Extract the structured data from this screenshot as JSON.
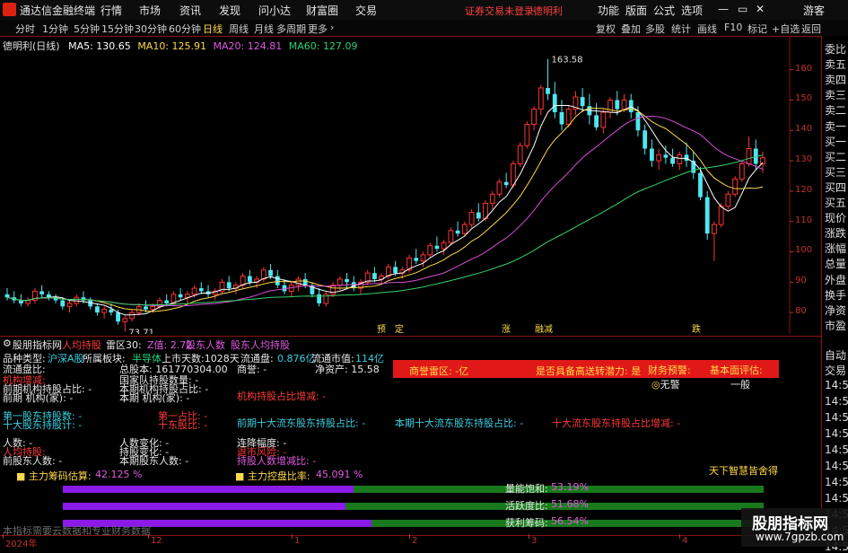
{
  "titlebar": {
    "app_name": "通达信金融终端",
    "menus": [
      "行情",
      "市场",
      "资讯",
      "发现",
      "问小达",
      "财富圈",
      "交易"
    ],
    "notice": "证券交易未登录",
    "stock_name": "德明利",
    "right_menus": [
      "功能",
      "版面",
      "公式",
      "选项"
    ],
    "guest": "游客"
  },
  "periodbar": {
    "periods": [
      "分时",
      "1分钟",
      "5分钟",
      "15分钟",
      "30分钟",
      "60分钟",
      "日线",
      "周线",
      "月线",
      "多周期",
      "更多"
    ],
    "active_period": "日线",
    "tools": [
      "复权",
      "叠加",
      "多股",
      "统计",
      "画线",
      "F10",
      "标记",
      "+自选",
      "返回"
    ]
  },
  "chart_header": {
    "title": "德明利(日线)",
    "ma5": "MA5: 130.65",
    "ma10": "MA10: 125.91",
    "ma20": "MA20: 124.81",
    "ma60": "MA60: 127.09"
  },
  "chart_data": {
    "type": "candlestick",
    "y_ticks": [
      160,
      150,
      140,
      130,
      120,
      110,
      100,
      90,
      80
    ],
    "ylim": [
      75,
      167
    ],
    "high_annotation": "163.58",
    "low_annotation": "73.71",
    "colors": {
      "up": "#ff3333",
      "down": "#50e6f0",
      "ma5": "#ffffff",
      "ma10": "#ffd84a",
      "ma20": "#d84fd8",
      "ma60": "#36d36a"
    },
    "candles": [
      [
        86,
        88,
        84,
        85
      ],
      [
        85,
        87,
        83,
        84
      ],
      [
        84,
        86,
        82,
        83
      ],
      [
        83,
        85,
        82,
        84
      ],
      [
        84,
        88,
        83,
        87
      ],
      [
        87,
        89,
        85,
        86
      ],
      [
        86,
        87,
        84,
        85
      ],
      [
        85,
        86,
        83,
        84
      ],
      [
        84,
        85,
        81,
        82
      ],
      [
        82,
        84,
        80,
        83
      ],
      [
        83,
        86,
        82,
        85
      ],
      [
        85,
        87,
        83,
        84
      ],
      [
        84,
        85,
        81,
        82
      ],
      [
        82,
        83,
        79,
        80
      ],
      [
        80,
        82,
        78,
        81
      ],
      [
        81,
        83,
        79,
        80
      ],
      [
        80,
        81,
        76,
        77
      ],
      [
        77,
        79,
        73.71,
        78
      ],
      [
        78,
        81,
        77,
        80
      ],
      [
        80,
        83,
        79,
        82
      ],
      [
        82,
        84,
        80,
        81
      ],
      [
        81,
        83,
        80,
        82
      ],
      [
        82,
        85,
        81,
        84
      ],
      [
        84,
        86,
        82,
        83
      ],
      [
        83,
        87,
        82,
        86
      ],
      [
        86,
        88,
        84,
        85
      ],
      [
        85,
        87,
        83,
        86
      ],
      [
        86,
        89,
        85,
        88
      ],
      [
        88,
        90,
        86,
        87
      ],
      [
        87,
        89,
        85,
        86
      ],
      [
        86,
        88,
        84,
        87
      ],
      [
        87,
        91,
        86,
        90
      ],
      [
        90,
        92,
        87,
        88
      ],
      [
        88,
        90,
        86,
        89
      ],
      [
        89,
        93,
        88,
        92
      ],
      [
        92,
        94,
        89,
        90
      ],
      [
        90,
        92,
        88,
        91
      ],
      [
        91,
        95,
        90,
        94
      ],
      [
        94,
        96,
        91,
        92
      ],
      [
        92,
        94,
        88,
        89
      ],
      [
        89,
        91,
        86,
        87
      ],
      [
        87,
        90,
        85,
        89
      ],
      [
        89,
        92,
        87,
        91
      ],
      [
        91,
        93,
        88,
        89
      ],
      [
        89,
        90,
        85,
        86
      ],
      [
        86,
        88,
        82,
        83
      ],
      [
        83,
        87,
        82,
        86
      ],
      [
        86,
        90,
        85,
        89
      ],
      [
        89,
        92,
        87,
        91
      ],
      [
        91,
        93,
        88,
        90
      ],
      [
        90,
        92,
        87,
        88
      ],
      [
        88,
        91,
        86,
        90
      ],
      [
        90,
        94,
        89,
        93
      ],
      [
        93,
        95,
        90,
        91
      ],
      [
        91,
        93,
        89,
        92
      ],
      [
        92,
        96,
        91,
        95
      ],
      [
        95,
        97,
        92,
        93
      ],
      [
        93,
        95,
        91,
        94
      ],
      [
        94,
        99,
        93,
        98
      ],
      [
        98,
        101,
        96,
        97
      ],
      [
        97,
        100,
        95,
        99
      ],
      [
        99,
        103,
        98,
        102
      ],
      [
        102,
        105,
        100,
        101
      ],
      [
        101,
        104,
        99,
        103
      ],
      [
        103,
        108,
        102,
        107
      ],
      [
        107,
        110,
        105,
        106
      ],
      [
        106,
        110,
        105,
        109
      ],
      [
        109,
        114,
        108,
        113
      ],
      [
        113,
        116,
        110,
        111
      ],
      [
        111,
        117,
        110,
        116
      ],
      [
        116,
        120,
        114,
        119
      ],
      [
        119,
        124,
        118,
        123
      ],
      [
        123,
        126,
        121,
        122
      ],
      [
        122,
        130,
        121,
        129
      ],
      [
        129,
        136,
        128,
        135
      ],
      [
        135,
        143,
        134,
        142
      ],
      [
        142,
        148,
        140,
        147
      ],
      [
        147,
        155,
        145,
        154
      ],
      [
        154,
        163.58,
        150,
        152
      ],
      [
        152,
        156,
        144,
        146
      ],
      [
        146,
        150,
        140,
        142
      ],
      [
        142,
        148,
        141,
        147
      ],
      [
        147,
        153,
        145,
        151
      ],
      [
        151,
        154,
        146,
        148
      ],
      [
        148,
        152,
        142,
        145
      ],
      [
        145,
        149,
        140,
        141
      ],
      [
        141,
        147,
        139,
        146
      ],
      [
        146,
        151,
        144,
        150
      ],
      [
        150,
        153,
        145,
        147
      ],
      [
        147,
        152,
        146,
        150
      ],
      [
        150,
        152,
        144,
        146
      ],
      [
        146,
        148,
        138,
        140
      ],
      [
        140,
        142,
        132,
        134
      ],
      [
        134,
        137,
        128,
        130
      ],
      [
        130,
        134,
        127,
        132
      ],
      [
        132,
        135,
        129,
        131
      ],
      [
        131,
        134,
        128,
        129
      ],
      [
        129,
        133,
        127,
        132
      ],
      [
        132,
        136,
        128,
        130
      ],
      [
        130,
        133,
        124,
        126
      ],
      [
        126,
        128,
        117,
        118
      ],
      [
        118,
        120,
        104,
        106
      ],
      [
        106,
        110,
        97,
        109
      ],
      [
        109,
        116,
        108,
        115
      ],
      [
        115,
        120,
        114,
        119
      ],
      [
        119,
        125,
        118,
        124
      ],
      [
        124,
        130,
        123,
        129
      ],
      [
        129,
        138,
        128,
        134
      ],
      [
        134,
        137,
        127,
        129
      ],
      [
        129,
        133,
        126,
        131
      ]
    ],
    "x_labels": [
      "2024年",
      "12",
      "1",
      "2",
      "3",
      "4"
    ],
    "event_markers": [
      "预",
      "定",
      "涨",
      "融",
      "减",
      "跌"
    ]
  },
  "right_panel": {
    "items": [
      "委比",
      "卖五",
      "卖四",
      "卖三",
      "卖二",
      "卖一",
      "买一",
      "买二",
      "买三",
      "买四",
      "买五",
      "现价",
      "涨跌",
      "涨幅",
      "总量",
      "外盘",
      "换手",
      "净资",
      "市盈"
    ],
    "lower_items": [
      "自动",
      "交易"
    ],
    "times": [
      "14:5",
      "14:5",
      "14:5",
      "14:5",
      "14:5",
      "14:5",
      "14:5",
      "14:5",
      "14:5",
      "14:5",
      "14:5"
    ]
  },
  "indicator": {
    "header": {
      "name": "股朋指标网",
      "a": "人均持股",
      "b": "雷区30:",
      "c": "Z值: 2.72",
      "d": "股东人数",
      "e": "股东人均持股"
    },
    "rows": {
      "pinzhong": "品种类型:",
      "pinzhong_val": "沪深A股",
      "bankuai": "所属板块:",
      "bankuai_val": "半导体",
      "shangshi": "上市天数:1028天",
      "liutongpan": "流通盘:",
      "liutongpan_val": "0.876亿",
      "liutong_shizhi": "流通市值:",
      "liutong_shizhi_val": "114亿",
      "liutongbi": "流通盘比:",
      "zongguben": "总股本: 161770304.00",
      "shangyu": "商誉: -",
      "jingzichan": "净资产: 15.58",
      "jigou_jm": "机构增减:",
      "guojia": "国家队持股数量: -",
      "qqjg_zb": "前期机构持股占比: -",
      "bqjg_zb": "本期机构持股占比: -",
      "qqjg_js": "前期 机构(家): -",
      "bqjg_js": "本期 机构(家): -",
      "jgbl": "机构持股占比增减: -",
      "gd1": "第一股东持股数: -",
      "gd1b": "第一占比: -",
      "gdsb": "十大股东持股计: -",
      "gdsb2": "十东股比: -",
      "qqsd": "前期十大流东股东持股占比: -",
      "bqsd": "本期十大流东股东持股占比: -",
      "sdbd": "十大流东股东持股占比增减: -",
      "rs": "人数: -",
      "rsbh": "人数变化: -",
      "lxfd": "连降幅度: -",
      "rjcg": "人均持股:",
      "chibh": "持股变化: -",
      "ycl": "退市风险: -",
      "qqgd": "前股东人数: -",
      "bqgd": "本期股东人数: -",
      "cgrs": "持股人数增减比: -"
    },
    "red_box": {
      "leiqu": "商誉雷区: -亿",
      "songzhuan": "是否具备高送转潜力: 是",
      "caiwu": "财务预警:",
      "caiwu_val": "无警",
      "jiben": "基本面评估:",
      "jiben_val": "一般"
    },
    "zhuli_chouma": "主力筹码估算:",
    "zhuli_chouma_val": "42.125 %",
    "zhuli_kongpan": "主力控盘比率:",
    "zhuli_kongpan_val": "45.091 %",
    "slogan": "天下智慧皆舍得",
    "bars": [
      {
        "label": "量能饱和:",
        "value": "53.19%",
        "purple": 0.5319
      },
      {
        "label": "活跃度比:",
        "value": "51.68%",
        "purple": 0.5168
      },
      {
        "label": "获利筹码:",
        "value": "56.54%",
        "purple": 0.5654
      }
    ],
    "footer": "本指标需要云数据和专业财务数据"
  },
  "watermark": {
    "title": "股朋指标网",
    "url": "www.7gpzb.com"
  }
}
